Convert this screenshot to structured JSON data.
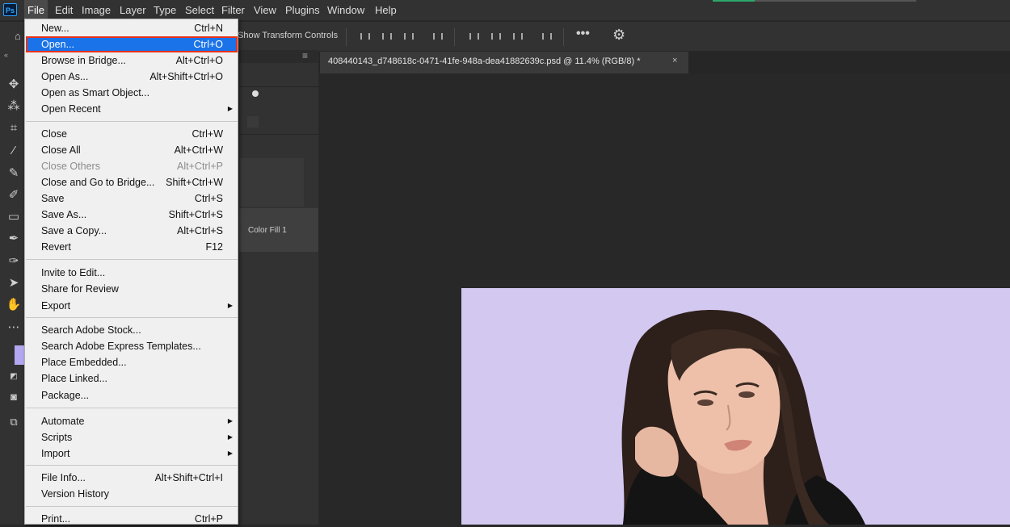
{
  "app": {
    "logo_text": "Ps"
  },
  "menubar": [
    "File",
    "Edit",
    "Image",
    "Layer",
    "Type",
    "Select",
    "Filter",
    "View",
    "Plugins",
    "Window",
    "Help"
  ],
  "options_bar": {
    "show_transform_controls": "Show Transform Controls"
  },
  "document": {
    "tab_title": "408440143_d748618c-0471-41fe-948a-dea41882639c.psd @ 11.4% (RGB/8) *",
    "close_glyph": "×"
  },
  "layers_panel": {
    "layer_name": "Color Fill 1"
  },
  "colors": {
    "accent": "#1a73e8",
    "canvas_bg": "#d2c8f0",
    "foreground_swatch": "#b3a7ef"
  },
  "file_menu": {
    "items": [
      {
        "label": "New...",
        "shortcut": "Ctrl+N"
      },
      {
        "label": "Open...",
        "shortcut": "Ctrl+O",
        "highlighted": true
      },
      {
        "label": "Browse in Bridge...",
        "shortcut": "Alt+Ctrl+O"
      },
      {
        "label": "Open As...",
        "shortcut": "Alt+Shift+Ctrl+O"
      },
      {
        "label": "Open as Smart Object...",
        "shortcut": ""
      },
      {
        "label": "Open Recent",
        "shortcut": "",
        "submenu": true
      },
      {
        "label": "Close",
        "shortcut": "Ctrl+W"
      },
      {
        "label": "Close All",
        "shortcut": "Alt+Ctrl+W"
      },
      {
        "label": "Close Others",
        "shortcut": "Alt+Ctrl+P",
        "disabled": true
      },
      {
        "label": "Close and Go to Bridge...",
        "shortcut": "Shift+Ctrl+W"
      },
      {
        "label": "Save",
        "shortcut": "Ctrl+S"
      },
      {
        "label": "Save As...",
        "shortcut": "Shift+Ctrl+S"
      },
      {
        "label": "Save a Copy...",
        "shortcut": "Alt+Ctrl+S"
      },
      {
        "label": "Revert",
        "shortcut": "F12"
      },
      {
        "label": "Invite to Edit...",
        "shortcut": ""
      },
      {
        "label": "Share for Review",
        "shortcut": ""
      },
      {
        "label": "Export",
        "shortcut": "",
        "submenu": true
      },
      {
        "label": "Search Adobe Stock...",
        "shortcut": ""
      },
      {
        "label": "Search Adobe Express Templates...",
        "shortcut": ""
      },
      {
        "label": "Place Embedded...",
        "shortcut": ""
      },
      {
        "label": "Place Linked...",
        "shortcut": ""
      },
      {
        "label": "Package...",
        "shortcut": ""
      },
      {
        "label": "Automate",
        "shortcut": "",
        "submenu": true
      },
      {
        "label": "Scripts",
        "shortcut": "",
        "submenu": true
      },
      {
        "label": "Import",
        "shortcut": "",
        "submenu": true
      },
      {
        "label": "File Info...",
        "shortcut": "Alt+Shift+Ctrl+I"
      },
      {
        "label": "Version History",
        "shortcut": ""
      },
      {
        "label": "Print...",
        "shortcut": "Ctrl+P"
      }
    ]
  }
}
